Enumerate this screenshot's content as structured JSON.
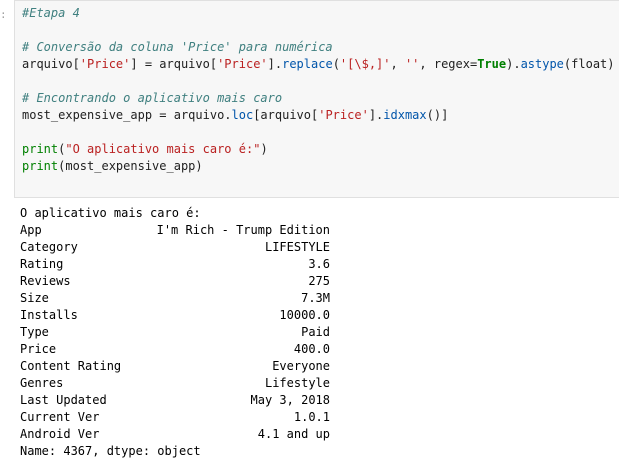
{
  "input_prompt": ":",
  "code": {
    "comment1": "#Etapa 4",
    "comment2": "# Conversão da coluna 'Price' para numérica",
    "l3": {
      "p1": "arquivo[",
      "s1": "'Price'",
      "p2": "] = arquivo[",
      "s2": "'Price'",
      "p3": "].",
      "m1": "replace",
      "p4": "(",
      "s3": "'[\\$,]'",
      "p5": ", ",
      "s4": "''",
      "p6": ", regex=",
      "k1": "True",
      "p7": ").",
      "m2": "astype",
      "p8": "(float)"
    },
    "comment3": "# Encontrando o aplicativo mais caro",
    "l6": {
      "p1": "most_expensive_app = arquivo.",
      "m1": "loc",
      "p2": "[arquivo[",
      "s1": "'Price'",
      "p3": "].",
      "m2": "idxmax",
      "p4": "()]"
    },
    "l8": {
      "b1": "print",
      "p1": "(",
      "s1": "\"O aplicativo mais caro é:\"",
      "p2": ")"
    },
    "l9": {
      "b1": "print",
      "p1": "(most_expensive_app)"
    }
  },
  "output": {
    "header": "O aplicativo mais caro é:",
    "rows": [
      {
        "key": "App",
        "value": "I'm Rich - Trump Edition"
      },
      {
        "key": "Category",
        "value": "LIFESTYLE"
      },
      {
        "key": "Rating",
        "value": "3.6"
      },
      {
        "key": "Reviews",
        "value": "275"
      },
      {
        "key": "Size",
        "value": "7.3M"
      },
      {
        "key": "Installs",
        "value": "10000.0"
      },
      {
        "key": "Type",
        "value": "Paid"
      },
      {
        "key": "Price",
        "value": "400.0"
      },
      {
        "key": "Content Rating",
        "value": "Everyone"
      },
      {
        "key": "Genres",
        "value": "Lifestyle"
      },
      {
        "key": "Last Updated",
        "value": "May 3, 2018"
      },
      {
        "key": "Current Ver",
        "value": "1.0.1"
      },
      {
        "key": "Android Ver",
        "value": "4.1 and up"
      }
    ],
    "footer": "Name: 4367, dtype: object"
  }
}
